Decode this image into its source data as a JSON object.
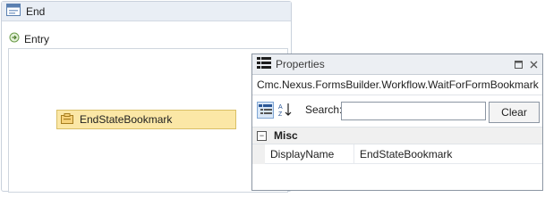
{
  "state": {
    "title": "End",
    "entry_label": "Entry",
    "activity_label": "EndStateBookmark"
  },
  "properties": {
    "title": "Properties",
    "type_name": "Cmc.Nexus.FormsBuilder.Workflow.WaitForFormBookmark",
    "search_label": "Search:",
    "search_value": "",
    "clear_label": "Clear",
    "category": "Misc",
    "rows": [
      {
        "name": "DisplayName",
        "value": "EndStateBookmark"
      }
    ]
  }
}
